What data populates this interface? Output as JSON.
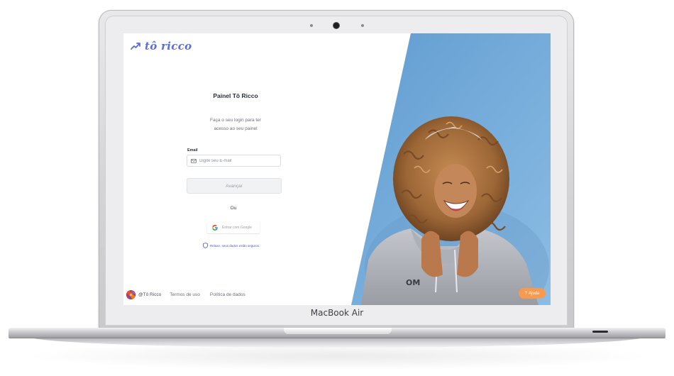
{
  "device": {
    "label": "MacBook Air"
  },
  "app": {
    "logo_text": "tô ricco",
    "title": "Painel Tô Ricco",
    "subtitle_line1": "Faça o seu login para ter",
    "subtitle_line2": "acesso ao seu painel"
  },
  "form": {
    "email_label": "Email",
    "email_placeholder": "Digite seu E-mail",
    "submit_label": "Avançar",
    "or_text": "Ou",
    "google_label": "Entrar com Google",
    "secure_text": "Relaxe, seus dados estão seguros."
  },
  "footer": {
    "handle": "@Tô Ricco",
    "terms_link": "Termos de uso",
    "privacy_link": "Política de dados"
  },
  "help": {
    "label": "Ajuda",
    "icon": "question-icon"
  },
  "colors": {
    "brand": "#5b6fd6",
    "help_button": "#f59a4e",
    "photo_background": "#6fa7d6",
    "button_disabled_bg": "#f1f2f4"
  }
}
